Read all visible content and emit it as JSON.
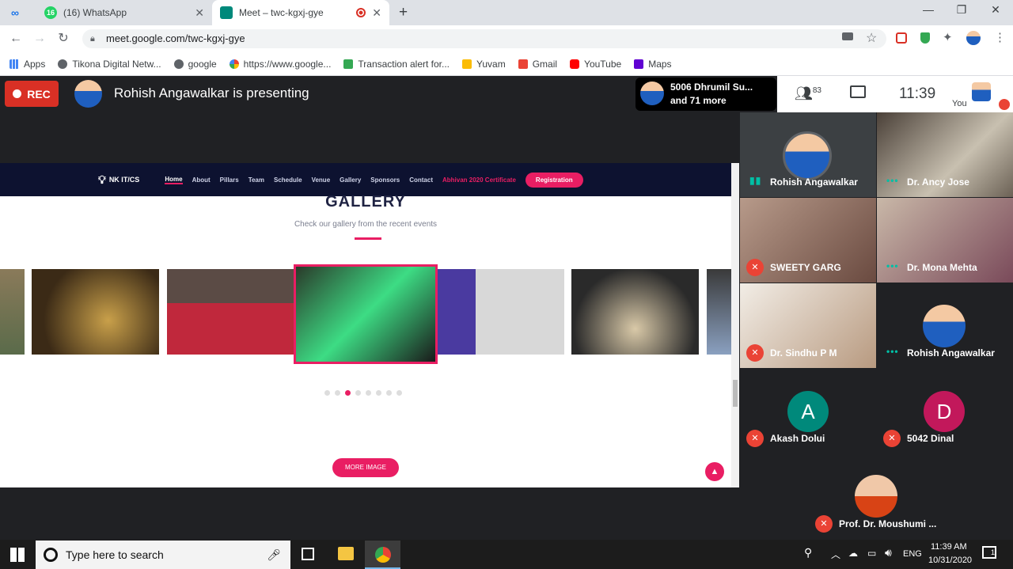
{
  "tabs": [
    {
      "label": "(16) WhatsApp",
      "badge": "16"
    },
    {
      "label": "Meet – twc-kgxj-gye"
    }
  ],
  "address": {
    "url": "meet.google.com/twc-kgxj-gye"
  },
  "bookmarks": [
    "Apps",
    "Tikona Digital Netw...",
    "google",
    "https://www.google...",
    "Transaction alert for...",
    "Yuvam",
    "Gmail",
    "YouTube",
    "Maps"
  ],
  "meet": {
    "rec_label": "REC",
    "presenting": "Rohish Angawalkar is presenting",
    "participants_line1": "5006 Dhrumil Su...",
    "participants_line2": "and 71 more",
    "people_count": "83",
    "time": "11:39",
    "you_label": "You"
  },
  "slide": {
    "logo": "NK IT/CS",
    "nav": [
      "Home",
      "About",
      "Pillars",
      "Team",
      "Schedule",
      "Venue",
      "Gallery",
      "Sponsors",
      "Contact"
    ],
    "nav_highlight": "Abhivan 2020 Certificate",
    "registration": "Registration",
    "title": "GALLERY",
    "subtitle": "Check our gallery from the recent events",
    "more_button": "MORE IMAGE"
  },
  "tiles": [
    {
      "name": "Rohish Angawalkar",
      "state": "speaking"
    },
    {
      "name": "Dr. Ancy Jose",
      "state": "active"
    },
    {
      "name": "SWEETY GARG",
      "state": "muted"
    },
    {
      "name": "Dr. Mona Mehta",
      "state": "active"
    },
    {
      "name": "Dr. Sindhu P M",
      "state": "muted"
    },
    {
      "name": "Rohish Angawalkar",
      "state": "active"
    },
    {
      "name": "Akash Dolui",
      "state": "muted",
      "letter": "A"
    },
    {
      "name": "5042 Dinal",
      "state": "muted",
      "letter": "D"
    },
    {
      "name": "Prof. Dr. Moushumi ...",
      "state": "muted"
    }
  ],
  "taskbar": {
    "search_placeholder": "Type here to search",
    "lang": "ENG",
    "time": "11:39 AM",
    "date": "10/31/2020",
    "notif_count": "1"
  }
}
